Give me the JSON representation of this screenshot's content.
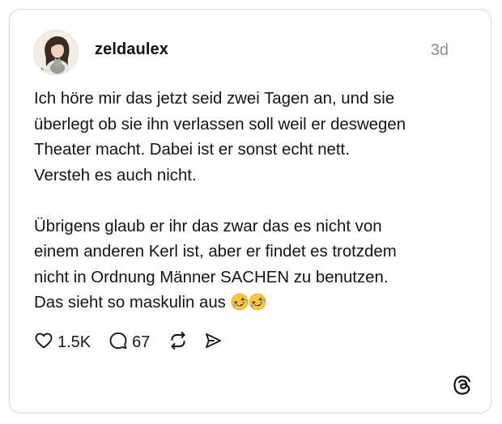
{
  "post": {
    "author": {
      "username": "zeldaulex",
      "avatar_icon": "avatar-woman-with-cat"
    },
    "timestamp": "3d",
    "paragraphs": [
      [
        "Ich höre mir das jetzt seid zwei Tagen an, und sie",
        "überlegt ob sie ihn verlassen soll weil er deswegen",
        "Theater macht. Dabei ist er sonst echt nett.",
        "Versteh es auch nicht."
      ],
      [
        "Übrigens glaub er ihr das zwar das es nicht von",
        "einem anderen Kerl ist, aber er findet es trotzdem",
        "nicht in Ordnung Männer SACHEN zu benutzen.",
        "Das sieht so maskulin aus"
      ]
    ],
    "trailing_emoji": "rolling-on-floor-laughing x2",
    "actions": {
      "likes": "1.5K",
      "replies": "67",
      "like_icon": "heart-icon",
      "reply_icon": "speech-bubble-icon",
      "repost_icon": "repost-icon",
      "share_icon": "send-icon"
    },
    "brand_icon": "threads-logo-icon"
  },
  "colors": {
    "text": "#141414",
    "muted": "#8e8e8e",
    "border": "#d8d8d8",
    "emoji_yellow": "#ffc93a",
    "emoji_tears": "#4aa8e8"
  }
}
